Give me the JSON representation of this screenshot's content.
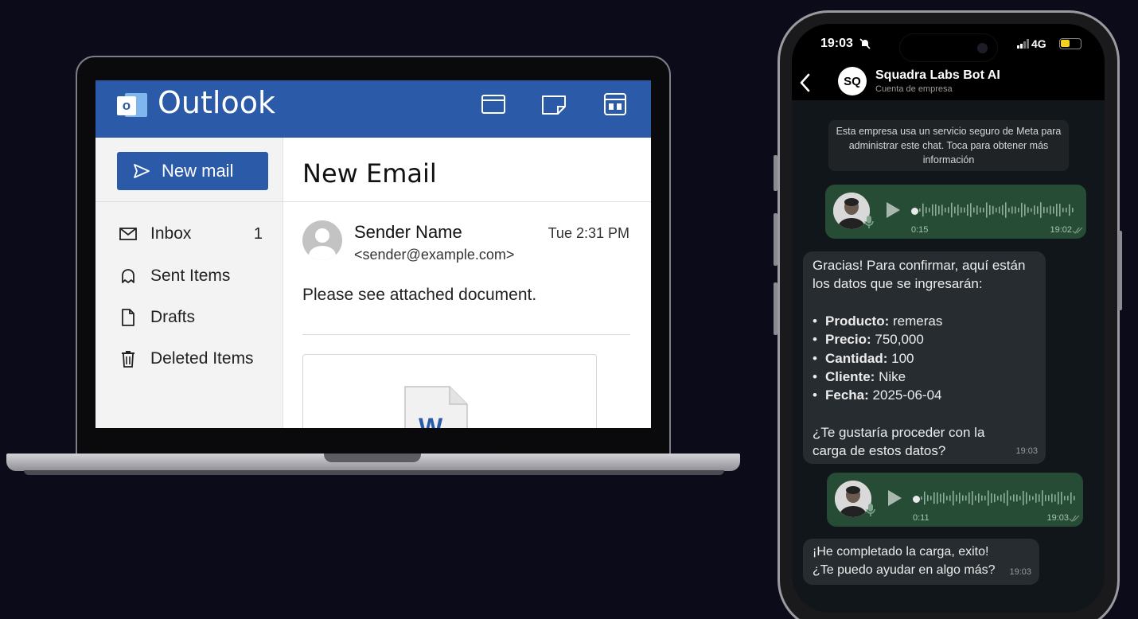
{
  "outlook": {
    "app_title": "Outlook",
    "logo_letter": "o",
    "new_mail_label": "New mail",
    "folders": [
      {
        "label": "Inbox",
        "count": "1",
        "icon": "envelope-icon"
      },
      {
        "label": "Sent Items",
        "count": "",
        "icon": "sent-icon"
      },
      {
        "label": "Drafts",
        "count": "",
        "icon": "draft-icon"
      },
      {
        "label": "Deleted Items",
        "count": "",
        "icon": "trash-icon"
      }
    ],
    "email": {
      "title": "New Email",
      "sender_name": "Sender Name",
      "sender_email": "<sender@example.com>",
      "time": "Tue 2:31 PM",
      "body": "Please see attached document.",
      "attachment_icon": "word-document-icon",
      "attachment_letter": "W"
    },
    "colors": {
      "brand": "#2b5aa8"
    }
  },
  "phone": {
    "status": {
      "time": "19:03",
      "network": "4G"
    },
    "chat": {
      "avatar_text": "SQ",
      "name": "Squadra Labs Bot AI",
      "subtitle": "Cuenta de empresa",
      "system_note": "Esta empresa usa un servicio seguro de Meta para administrar este chat. Toca para obtener más información"
    },
    "voice_messages": [
      {
        "duration": "0:15",
        "time": "19:02"
      },
      {
        "duration": "0:11",
        "time": "19:03"
      }
    ],
    "bot_message_1": {
      "intro": "Gracias! Para confirmar, aquí están los datos que se ingresarán:",
      "items": [
        {
          "label": "Producto:",
          "value": "remeras"
        },
        {
          "label": "Precio:",
          "value": "750,000"
        },
        {
          "label": "Cantidad:",
          "value": "100"
        },
        {
          "label": "Cliente:",
          "value": "Nike"
        },
        {
          "label": "Fecha:",
          "value": "2025-06-04"
        }
      ],
      "question": "¿Te gustaría proceder con la carga de estos datos?",
      "time": "19:03"
    },
    "bot_message_2": {
      "line1": "¡He completado la carga, exito!",
      "line2": "¿Te puedo ayudar en algo más?",
      "time": "19:03"
    },
    "colors": {
      "outgoing_bubble": "#264c35",
      "incoming_bubble": "#262c30"
    }
  }
}
